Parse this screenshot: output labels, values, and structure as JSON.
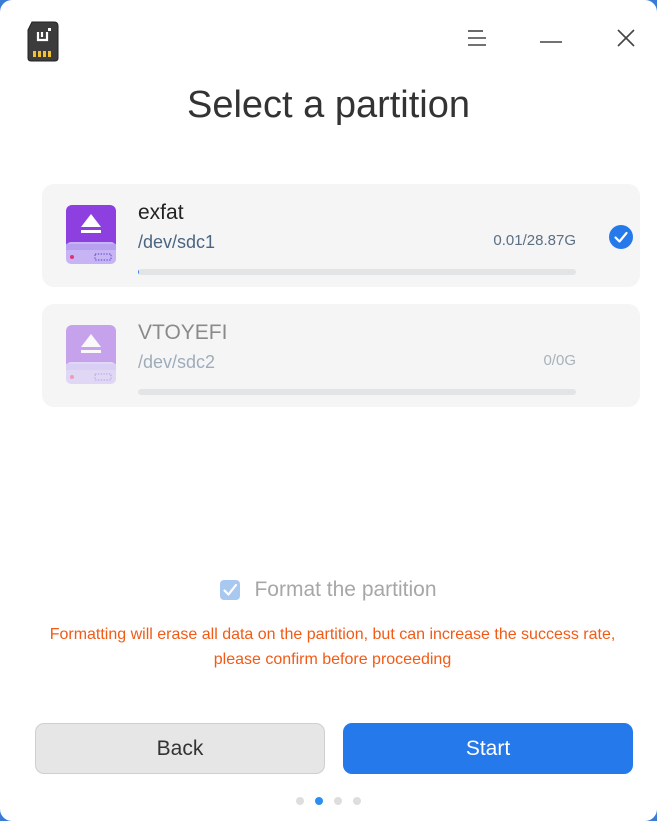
{
  "window": {
    "title": "Select a partition",
    "icons": {
      "app": "sd-card-icon",
      "menu": "menu-icon",
      "minimize": "minimize-icon",
      "close": "close-icon"
    }
  },
  "partitions": [
    {
      "name": "exfat",
      "device": "/dev/sdc1",
      "size": "0.01/28.87G",
      "usage_fraction": 0.0003,
      "selected": true,
      "enabled": true,
      "icon": "purple-drive-icon"
    },
    {
      "name": "VTOYEFI",
      "device": "/dev/sdc2",
      "size": "0/0G",
      "usage_fraction": 0,
      "selected": false,
      "enabled": false,
      "icon": "purple-drive-icon"
    }
  ],
  "format": {
    "label": "Format the partition",
    "checked": true,
    "enabled": false,
    "warning": "Formatting will erase all data on the partition, but can increase the success rate, please confirm before proceeding"
  },
  "buttons": {
    "back": "Back",
    "start": "Start"
  },
  "pager": {
    "total": 4,
    "current": 2
  },
  "colors": {
    "accent": "#2679ea",
    "warning": "#f25a16",
    "drive_purple": "#8e3fe0",
    "card_bg": "#f5f5f6"
  }
}
